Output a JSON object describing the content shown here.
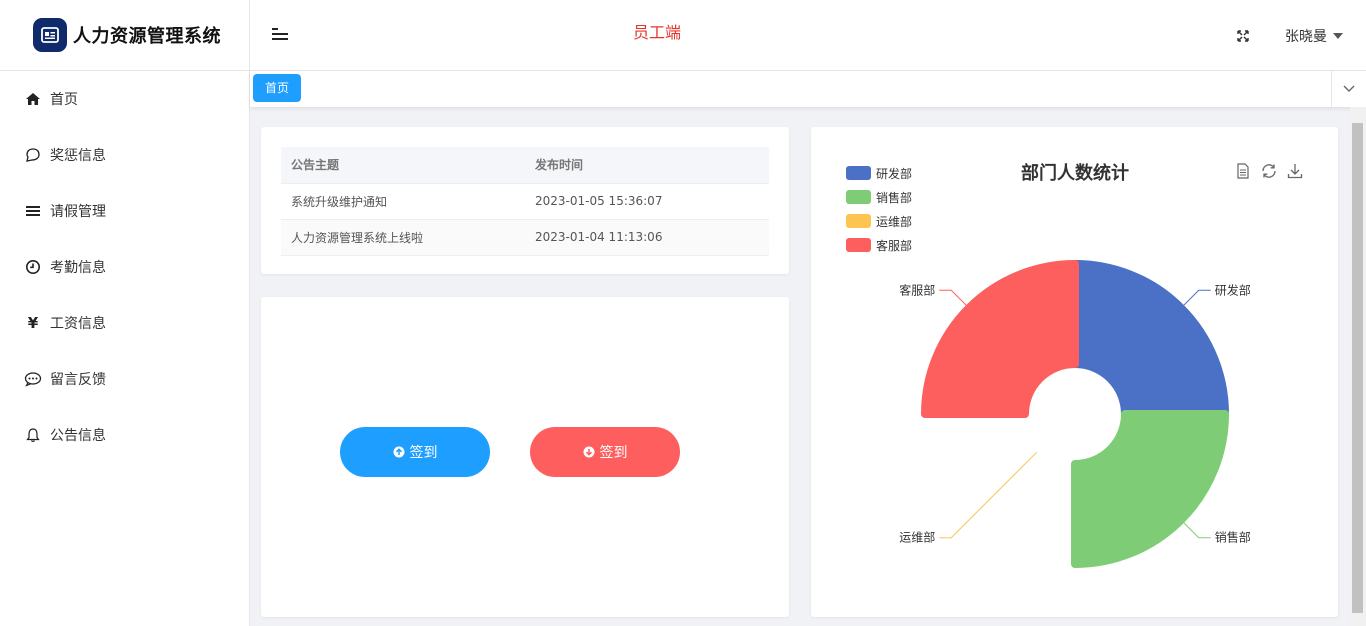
{
  "brand": {
    "title": "人力资源管理系统"
  },
  "header": {
    "role_label": "员工端",
    "user_name": "张晓曼"
  },
  "sidebar": {
    "items": [
      {
        "label": "首页",
        "icon": "home-icon"
      },
      {
        "label": "奖惩信息",
        "icon": "chat-bubble-icon"
      },
      {
        "label": "请假管理",
        "icon": "menu-list-icon"
      },
      {
        "label": "考勤信息",
        "icon": "clock-icon"
      },
      {
        "label": "工资信息",
        "icon": "yen-icon"
      },
      {
        "label": "留言反馈",
        "icon": "comment-dots-icon"
      },
      {
        "label": "公告信息",
        "icon": "bell-icon"
      }
    ]
  },
  "tabs": [
    {
      "label": "首页"
    }
  ],
  "notices": {
    "headers": [
      "公告主题",
      "发布时间"
    ],
    "rows": [
      {
        "title": "系统升级维护通知",
        "time": "2023-01-05 15:36:07"
      },
      {
        "title": "人力资源管理系统上线啦",
        "time": "2023-01-04 11:13:06"
      }
    ]
  },
  "checkin": {
    "checkin_label": "签到",
    "checkout_label": "签到"
  },
  "colors": {
    "primary": "#1e9fff",
    "danger": "#fe5e5e",
    "role": "#e5352b"
  },
  "chart_data": {
    "type": "pie",
    "subtype": "rose-donut",
    "title": "部门人数统计",
    "legend_position": "top-left",
    "series": [
      {
        "name": "研发部",
        "value": 3,
        "color": "#4a71c6"
      },
      {
        "name": "销售部",
        "value": 3,
        "color": "#7ecd76"
      },
      {
        "name": "运维部",
        "value": 0,
        "color": "#fdc550"
      },
      {
        "name": "客服部",
        "value": 3,
        "color": "#fd5f5f"
      }
    ]
  }
}
